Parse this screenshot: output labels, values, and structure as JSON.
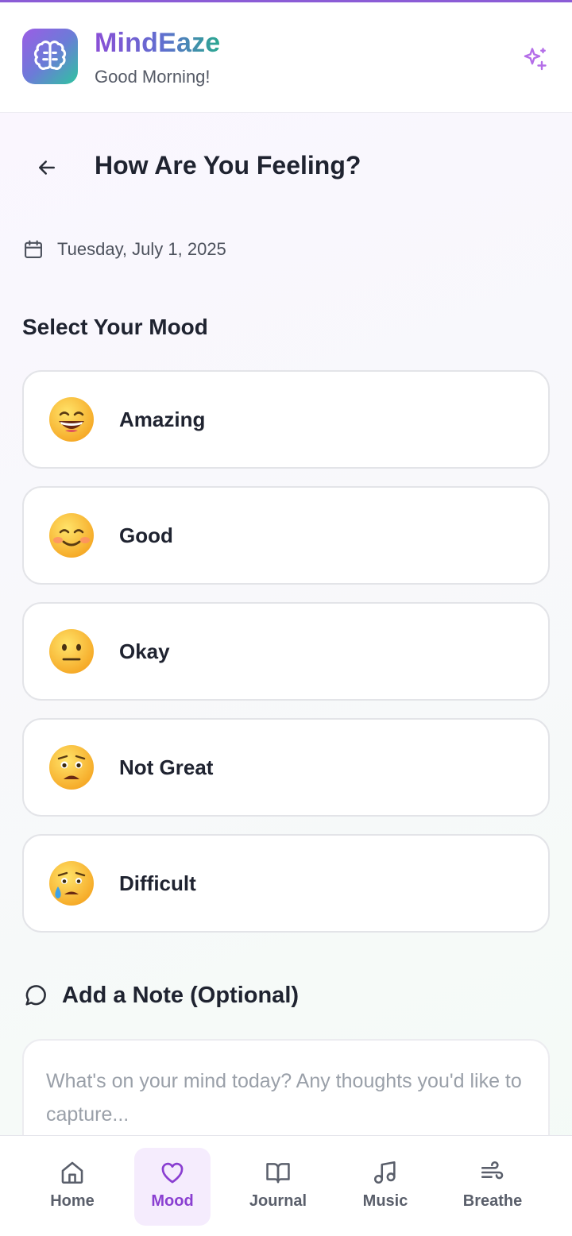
{
  "header": {
    "app_name": "MindEaze",
    "greeting": "Good Morning!"
  },
  "page": {
    "title": "How Are You Feeling?",
    "date": "Tuesday, July 1, 2025",
    "section_title": "Select Your Mood"
  },
  "moods": [
    {
      "label": "Amazing",
      "icon": "grinning-face-icon"
    },
    {
      "label": "Good",
      "icon": "smiling-face-icon"
    },
    {
      "label": "Okay",
      "icon": "neutral-face-icon"
    },
    {
      "label": "Not Great",
      "icon": "worried-face-icon"
    },
    {
      "label": "Difficult",
      "icon": "crying-face-icon"
    }
  ],
  "note": {
    "title": "Add a Note (Optional)",
    "placeholder": "What's on your mind today? Any thoughts you'd like to capture..."
  },
  "nav": {
    "items": [
      {
        "label": "Home",
        "icon": "home-icon"
      },
      {
        "label": "Mood",
        "icon": "heart-icon",
        "active": true
      },
      {
        "label": "Journal",
        "icon": "book-icon"
      },
      {
        "label": "Music",
        "icon": "music-note-icon"
      },
      {
        "label": "Breathe",
        "icon": "wind-icon"
      }
    ]
  },
  "colors": {
    "accent": "#8a3fd1",
    "brand_gradient_start": "#9b5de5",
    "brand_gradient_end": "#2ec4a0"
  }
}
